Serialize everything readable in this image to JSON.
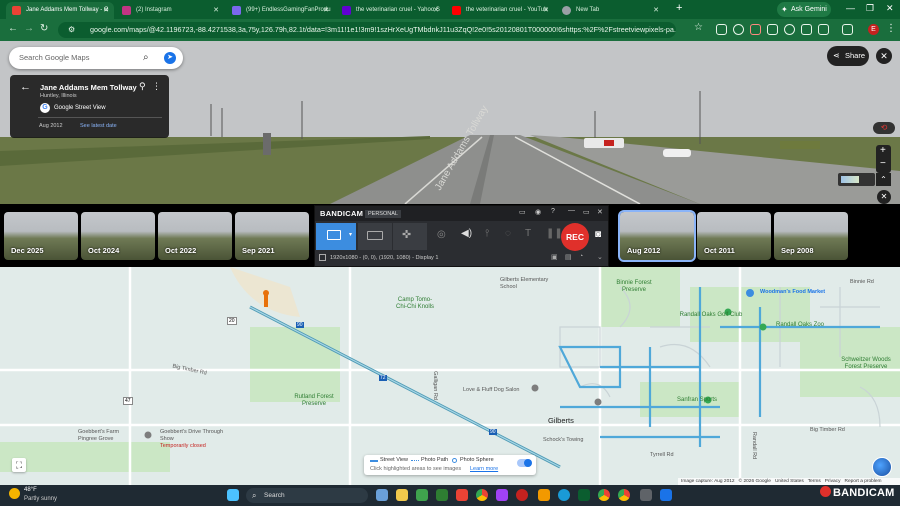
{
  "browser": {
    "tabs": [
      {
        "title": "Jane Addams Mem Tollway - G",
        "favicon_color": "#ea4335",
        "active": true
      },
      {
        "title": "(2) Instagram",
        "favicon_color": "#c13584",
        "active": false
      },
      {
        "title": "(99+) EndlessGamingFanProdu",
        "favicon_color": "#7b68ee",
        "active": false
      },
      {
        "title": "the veterinarian cruel - Yahoo S",
        "favicon_color": "#6001d2",
        "active": false
      },
      {
        "title": "the veterinarian cruel - YouTub",
        "favicon_color": "#ff0000",
        "active": false
      },
      {
        "title": "New Tab",
        "favicon_color": "#9aa0a6",
        "active": false
      }
    ],
    "new_tab_label": "+",
    "ask_gemini_label": "Ask Gemini",
    "window_controls": {
      "minimize": "—",
      "maximize": "❐",
      "close": "✕"
    },
    "url": "google.com/maps/@42.1196723,-88.4271538,3a,75y,126.79h,82.1t/data=!3m11!1e1!3m9!1szHrXeUgTMbdnkJ11u3ZqQ!2e0!5s20120801T000000!6shttps:%2F%2Fstreetviewpixels-pa.googleapis.com%...",
    "profile_initial": "E",
    "accent": "#1a6e3d"
  },
  "maps": {
    "search_placeholder": "Search Google Maps",
    "location": {
      "title": "Jane Addams Mem Tollway",
      "subtitle": "Huntley, Illinois",
      "source": "Google Street View",
      "capture_date": "Aug 2012",
      "latest_link": "See latest date"
    },
    "share_label": "Share",
    "close_glyph": "✕",
    "zoom_in": "+",
    "zoom_out": "−",
    "timeline": [
      {
        "label": "Dec 2025",
        "selected": false
      },
      {
        "label": "Oct 2024",
        "selected": false
      },
      {
        "label": "Oct 2022",
        "selected": false
      },
      {
        "label": "Sep 2021",
        "selected": false
      },
      {
        "label": "Aug 2012",
        "selected": true
      },
      {
        "label": "Oct 2011",
        "selected": false
      },
      {
        "label": "Sep 2008",
        "selected": false
      }
    ],
    "road_marking": "Jane Addams Tollway",
    "places": [
      {
        "name": "Camp Tomo-Chi-Chi Knolls"
      },
      {
        "name": "Big Timber Rd"
      },
      {
        "name": "Rutland Forest Preserve"
      },
      {
        "name": "Goebbert's Farm Pingree Grove"
      },
      {
        "name": "Goebbert's Drive Through Show"
      },
      {
        "name": "Temporarily closed"
      },
      {
        "name": "Love & Fluff Dog Salon"
      },
      {
        "name": "Gilberts Elementary School"
      },
      {
        "name": "Gilberts"
      },
      {
        "name": "Schock's Towing"
      },
      {
        "name": "Binnie Forest Preserve"
      },
      {
        "name": "Randall Oaks Golf Club"
      },
      {
        "name": "Randall Oaks Zoo"
      },
      {
        "name": "Woodman's Food Market"
      },
      {
        "name": "Sanfran Sports"
      },
      {
        "name": "Schweitzer Woods Forest Preserve"
      },
      {
        "name": "Binnie Rd"
      },
      {
        "name": "Randall Rd"
      },
      {
        "name": "Tyrrell Rd"
      },
      {
        "name": "Galligan Rd"
      },
      {
        "name": "Big Timber Rd"
      }
    ],
    "route_labels": [
      "47",
      "90",
      "20",
      "90",
      "72"
    ],
    "legend": {
      "street_view": "Street View",
      "photo_path": "Photo Path",
      "photo_sphere": "Photo Sphere",
      "hint": "Click highlighted areas to see images",
      "learn_more": "Learn more"
    },
    "attribution": [
      "Image capture: Aug 2012",
      "© 2026 Google",
      "United States",
      "Terms",
      "Privacy",
      "Report a problem"
    ]
  },
  "bandicam": {
    "brand": "BANDICAM",
    "edition": "PERSONAL",
    "record_label": "REC",
    "status": "1920x1080 - (0, 0), (1920, 1080) - Display 1",
    "accent": "#3c8de0",
    "watermark": "BANDICAM"
  },
  "taskbar": {
    "weather_temp": "48°F",
    "weather_desc": "Partly sunny",
    "search_placeholder": "Search"
  }
}
